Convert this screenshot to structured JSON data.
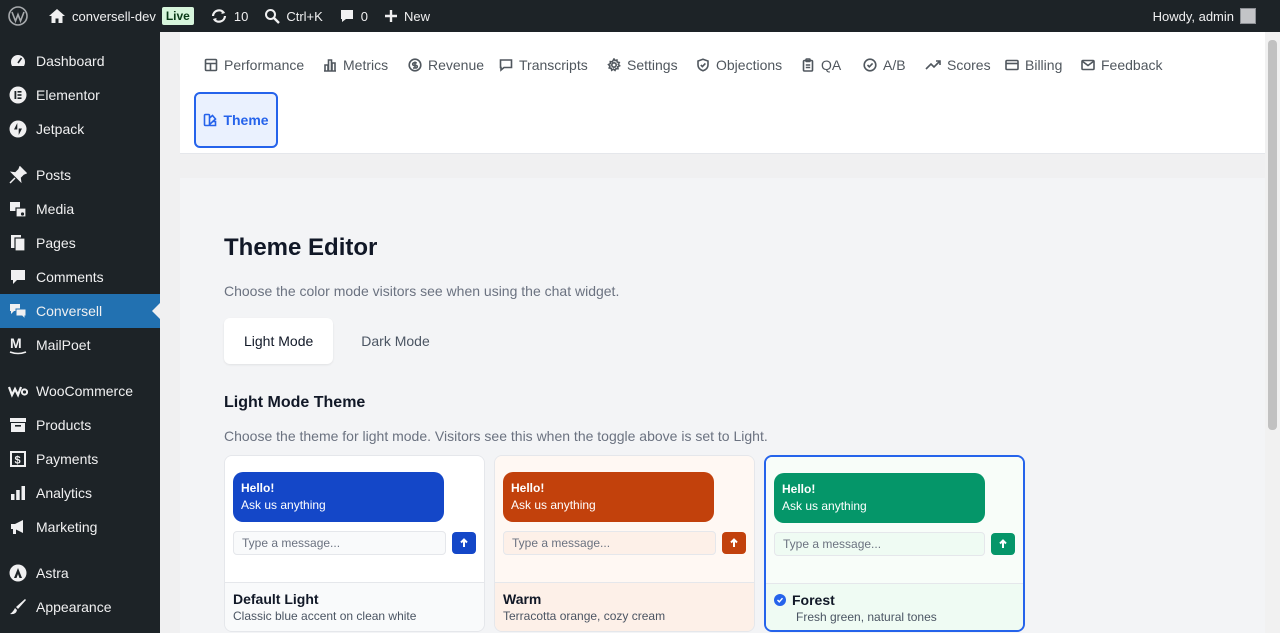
{
  "adminbar": {
    "site_name": "conversell-dev",
    "live_badge": "Live",
    "updates_count": "10",
    "search_shortcut": "Ctrl+K",
    "comments_count": "0",
    "new_label": "New",
    "howdy": "Howdy, admin"
  },
  "sidebar": {
    "items": [
      {
        "label": "Dashboard",
        "icon": "dashboard-icon"
      },
      {
        "label": "Elementor",
        "icon": "elementor-icon"
      },
      {
        "label": "Jetpack",
        "icon": "jetpack-icon"
      },
      {
        "label": "Posts",
        "icon": "pin-icon"
      },
      {
        "label": "Media",
        "icon": "media-icon"
      },
      {
        "label": "Pages",
        "icon": "pages-icon"
      },
      {
        "label": "Comments",
        "icon": "comment-icon"
      },
      {
        "label": "Conversell",
        "icon": "chat-icon",
        "active": true
      },
      {
        "label": "MailPoet",
        "icon": "mailpoet-icon"
      },
      {
        "label": "WooCommerce",
        "icon": "woo-icon"
      },
      {
        "label": "Products",
        "icon": "archive-icon"
      },
      {
        "label": "Payments",
        "icon": "dollar-icon"
      },
      {
        "label": "Analytics",
        "icon": "bar-chart-icon"
      },
      {
        "label": "Marketing",
        "icon": "megaphone-icon"
      },
      {
        "label": "Astra",
        "icon": "astra-icon"
      },
      {
        "label": "Appearance",
        "icon": "brush-icon"
      }
    ]
  },
  "tabs": [
    {
      "label": "Performance",
      "icon": "layout-icon"
    },
    {
      "label": "Metrics",
      "icon": "bar-chart-icon"
    },
    {
      "label": "Revenue",
      "icon": "coin-icon"
    },
    {
      "label": "Transcripts",
      "icon": "message-icon"
    },
    {
      "label": "Settings",
      "icon": "gear-icon"
    },
    {
      "label": "Objections",
      "icon": "shield-icon"
    },
    {
      "label": "QA",
      "icon": "clipboard-icon"
    },
    {
      "label": "A/B",
      "icon": "check-circle-icon"
    },
    {
      "label": "Scores",
      "icon": "trending-up-icon"
    },
    {
      "label": "Billing",
      "icon": "credit-card-icon"
    },
    {
      "label": "Feedback",
      "icon": "mail-icon"
    },
    {
      "label": "Theme",
      "icon": "palette-icon",
      "active": true
    }
  ],
  "theme_editor": {
    "title": "Theme Editor",
    "subtitle": "Choose the color mode visitors see when using the chat widget.",
    "mode_tabs": [
      "Light Mode",
      "Dark Mode"
    ],
    "section_title": "Light Mode Theme",
    "section_subtitle": "Choose the theme for light mode. Visitors see this when the toggle above is set to Light.",
    "bubble_title": "Hello!",
    "bubble_text": "Ask us anything",
    "input_placeholder": "Type a message...",
    "cards": [
      {
        "name": "Default Light",
        "desc": "Classic blue accent on clean white",
        "accent": "#1447c8",
        "bg": "#ffffff",
        "footer_bg": "#f9fafb",
        "input_bg": "#f9fafb",
        "selected": false
      },
      {
        "name": "Warm",
        "desc": "Terracotta orange, cozy cream",
        "accent": "#c2410c",
        "bg": "#fff8f3",
        "footer_bg": "#fdf0e8",
        "input_bg": "#fdf0e8",
        "selected": false
      },
      {
        "name": "Forest",
        "desc": "Fresh green, natural tones",
        "accent": "#059669",
        "bg": "#f8fdf9",
        "footer_bg": "#effbf3",
        "input_bg": "#effbf3",
        "selected": true
      }
    ]
  }
}
